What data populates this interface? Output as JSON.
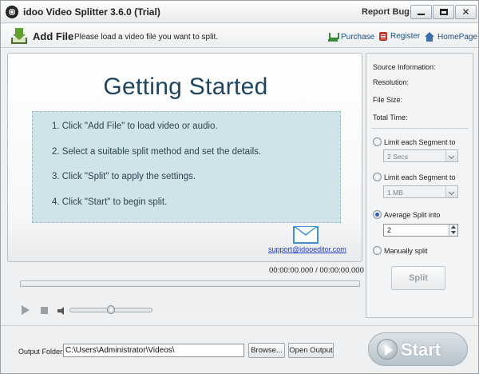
{
  "window": {
    "title": "idoo Video Splitter 3.6.0 (Trial)",
    "report_bugs": "Report Bugs",
    "close_glyph": "✕"
  },
  "toolbar": {
    "add_file_label": "Add File",
    "hint": "Please load a video file you want to split.",
    "purchase_label": "Purchase",
    "register_label": "Register",
    "homepage_label": "HomePage"
  },
  "preview": {
    "heading": "Getting Started",
    "steps": [
      "1. Click \"Add File\" to load video or audio.",
      "2. Select a suitable split method and set the details.",
      "3. Click \"Split\" to apply the settings.",
      "4. Click \"Start\" to begin split."
    ],
    "support_email": "support@idooeditor.com"
  },
  "player": {
    "time_readout": "00:00:00.000 / 00:00:00.000",
    "progress": 0,
    "volume": 0.5
  },
  "info": {
    "source_information": "Source Information:",
    "resolution": "Resolution:",
    "file_size": "File Size:",
    "total_time": "Total Time:"
  },
  "split_options": {
    "limit_time_label": "Limit each Segment to",
    "limit_time_value": "2 Secs",
    "limit_size_label": "Limit each Segment to",
    "limit_size_value": "1 MB",
    "average_label": "Average Split into",
    "average_value": "2",
    "manual_label": "Manually split",
    "selected": "average",
    "split_button": "Split"
  },
  "output": {
    "label": "Output Folder:",
    "path": "C:\\Users\\Administrator\\Videos\\",
    "browse_button": "Browse...",
    "open_output_button": "Open Output"
  },
  "start_button": "Start",
  "colors": {
    "heading": "#1f4560",
    "steps_box": "#cfe3e8",
    "link": "#1f3bbf",
    "selected_radio": "#2b5fb4"
  }
}
